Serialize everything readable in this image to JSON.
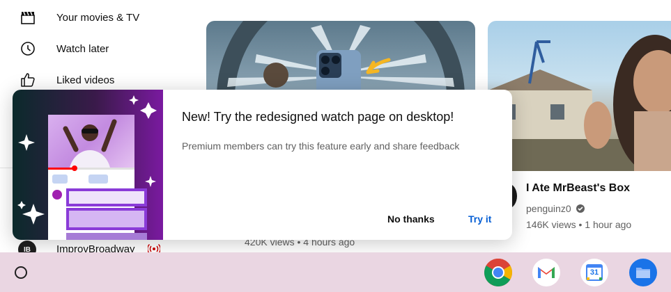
{
  "sidebar": {
    "items": [
      {
        "label": "Your movies & TV",
        "icon": "clapperboard-icon"
      },
      {
        "label": "Watch later",
        "icon": "clock-icon"
      },
      {
        "label": "Liked videos",
        "icon": "thumbs-up-icon"
      }
    ],
    "subscription": {
      "avatar_text": "IB",
      "name": "ImprovBroadway",
      "live_icon": "live-icon"
    }
  },
  "videos": [
    {
      "meta": "420K views • 4 hours ago"
    },
    {
      "title": "I Ate MrBeast's Box",
      "channel": "penguinz0",
      "verified_icon": "verified-check-icon",
      "meta": "146K views • 1 hour ago"
    }
  ],
  "promo": {
    "title": "New! Try the redesigned watch page on desktop!",
    "subtitle": "Premium members can try this feature early and share feedback",
    "dismiss_label": "No thanks",
    "accept_label": "Try it"
  },
  "shelf": {
    "launcher_icon": "launcher-icon",
    "apps": [
      "chrome-icon",
      "gmail-icon",
      "calendar-icon",
      "files-icon"
    ],
    "calendar_day": "31"
  },
  "colors": {
    "link_blue": "#065fd4",
    "shelf_bg": "#ead6e2",
    "live_red": "#cc0000"
  }
}
